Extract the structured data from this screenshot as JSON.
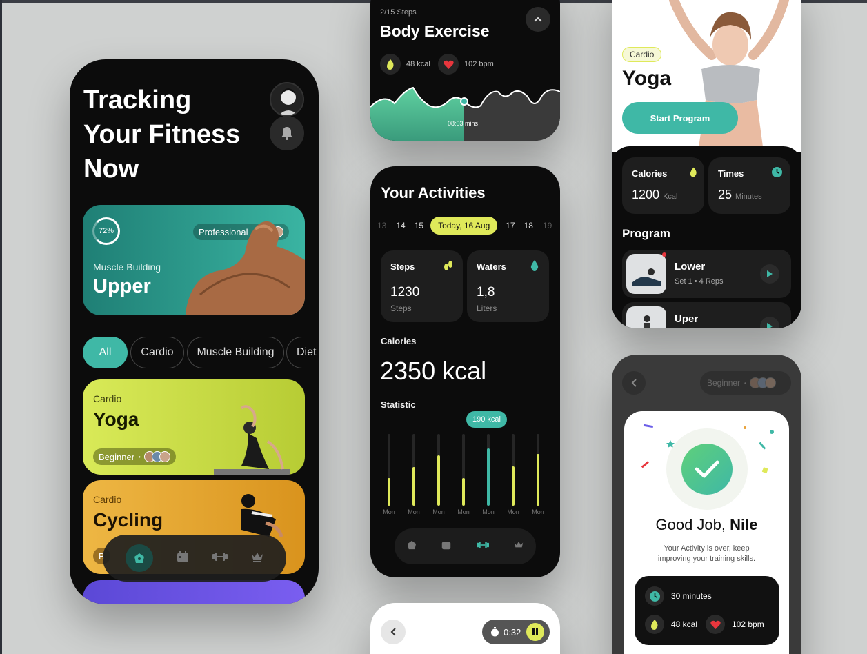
{
  "colors": {
    "accent_teal": "#3fb8a6",
    "accent_lime": "#dfe95a",
    "yoga_card": "#c8dc45",
    "cycling_card": "#e7a73a",
    "dark": "#0c0c0c"
  },
  "phone1": {
    "title_line1": "Tracking",
    "title_line2": "Your Fitness",
    "title_line3": "Now",
    "hero": {
      "progress_text": "72%",
      "progress": 0.72,
      "level": "Professional",
      "category": "Muscle Building",
      "name": "Upper"
    },
    "chips": [
      "All",
      "Cardio",
      "Muscle Building",
      "Diet"
    ],
    "cards": [
      {
        "category": "Cardio",
        "name": "Yoga",
        "level": "Beginner"
      },
      {
        "category": "Cardio",
        "name": "Cycling",
        "level": "B"
      }
    ],
    "nav_icons": [
      "home-icon",
      "calendar-icon",
      "dumbbell-icon",
      "crown-icon"
    ]
  },
  "phone2_top": {
    "steps": "2/15 Steps",
    "title": "Body Exercise",
    "kcal": "48 kcal",
    "bpm": "102 bpm",
    "time": "08:03 mins"
  },
  "phone2": {
    "title": "Your Activities",
    "dates": [
      "13",
      "14",
      "15",
      "Today, 16 Aug",
      "17",
      "18",
      "19"
    ],
    "steps": {
      "label": "Steps",
      "value": "1230",
      "unit": "Steps"
    },
    "waters": {
      "label": "Waters",
      "value": "1,8",
      "unit": "Liters"
    },
    "calories_label": "Calories",
    "calories_value": "2350 kcal",
    "statistic_label": "Statistic",
    "tooltip": "190 kcal",
    "bars": [
      {
        "day": "Mon",
        "level": 0.38,
        "color": "#dfe95a"
      },
      {
        "day": "Mon",
        "level": 0.54,
        "color": "#dfe95a"
      },
      {
        "day": "Mon",
        "level": 0.7,
        "color": "#dfe95a"
      },
      {
        "day": "Mon",
        "level": 0.38,
        "color": "#dfe95a"
      },
      {
        "day": "Mon",
        "level": 0.8,
        "color": "#3fb8a6"
      },
      {
        "day": "Mon",
        "level": 0.55,
        "color": "#dfe95a"
      },
      {
        "day": "Mon",
        "level": 0.72,
        "color": "#dfe95a"
      }
    ]
  },
  "phone2_bottom": {
    "timer": "0:32"
  },
  "phone3_top": {
    "tag": "Cardio",
    "title": "Yoga",
    "button": "Start Program",
    "calories": {
      "label": "Calories",
      "value": "1200",
      "unit": "Kcal"
    },
    "times": {
      "label": "Times",
      "value": "25",
      "unit": "Minutes"
    },
    "program_label": "Program",
    "programs": [
      {
        "name": "Lower",
        "detail": "Set 1",
        "reps": "4 Reps"
      },
      {
        "name": "Uper"
      }
    ]
  },
  "phone3": {
    "level": "Beginner",
    "heading_pre": "Good Job, ",
    "heading_name": "Nile",
    "message_line1": "Your Activity is over, keep",
    "message_line2": "improving your training skills.",
    "minutes": "30 minutes",
    "kcal": "48 kcal",
    "bpm": "102 bpm"
  }
}
